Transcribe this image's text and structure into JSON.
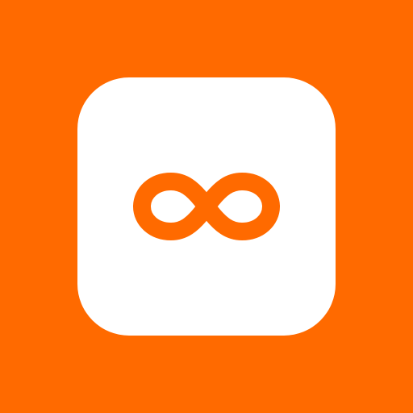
{
  "app_icon": {
    "background_color": "#ff6a00",
    "tile_color": "#ffffff",
    "logo_color": "#ff6a00",
    "logo_icon": "infinity-icon"
  }
}
